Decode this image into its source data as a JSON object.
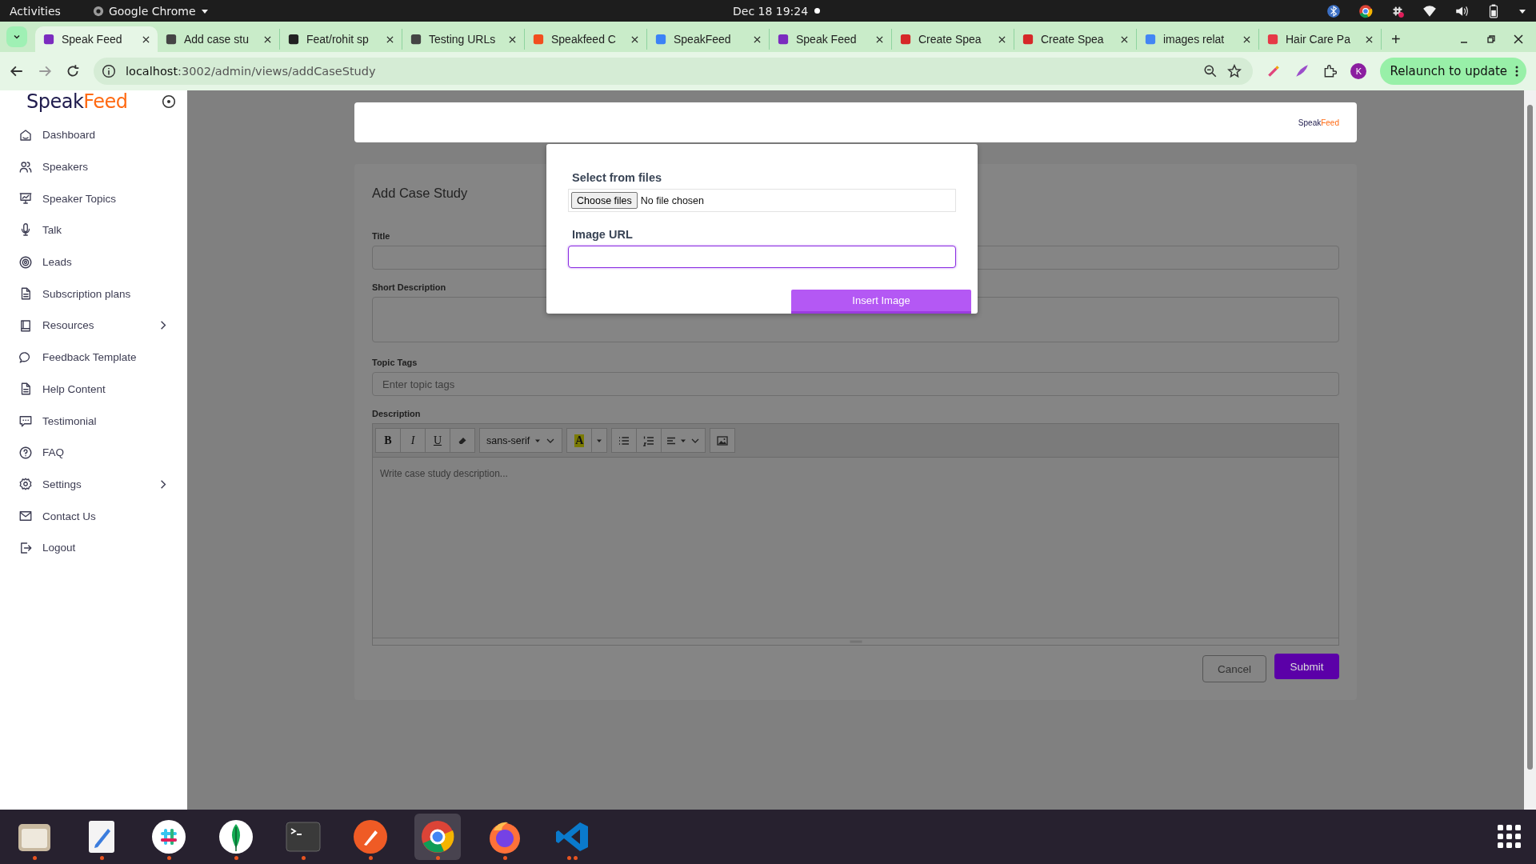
{
  "system_bar": {
    "activities": "Activities",
    "app_name": "Google Chrome",
    "clock": "Dec 18  19:24"
  },
  "browser": {
    "tabs": [
      {
        "title": "Speak Feed",
        "selected": true
      },
      {
        "title": "Add case stu",
        "selected": false
      },
      {
        "title": "Feat/rohit sp",
        "selected": false
      },
      {
        "title": "Testing URLs",
        "selected": false
      },
      {
        "title": "Speakfeed C",
        "selected": false
      },
      {
        "title": "SpeakFeed",
        "selected": false
      },
      {
        "title": "Speak Feed",
        "selected": false
      },
      {
        "title": "Create Spea",
        "selected": false
      },
      {
        "title": "Create Spea",
        "selected": false
      },
      {
        "title": "images relat",
        "selected": false
      },
      {
        "title": "Hair Care Pa",
        "selected": false
      }
    ],
    "new_tab": "+",
    "url_host": "localhost",
    "url_path": ":3002/admin/views/addCaseStudy",
    "profile_initial": "K",
    "relaunch_button": "Relaunch to update"
  },
  "sidebar": {
    "logo_first": "Speak",
    "logo_second": "Feed",
    "items": [
      {
        "label": "Dashboard",
        "expandable": false
      },
      {
        "label": "Speakers",
        "expandable": false
      },
      {
        "label": "Speaker Topics",
        "expandable": false
      },
      {
        "label": "Talk",
        "expandable": false
      },
      {
        "label": "Leads",
        "expandable": false
      },
      {
        "label": "Subscription plans",
        "expandable": false
      },
      {
        "label": "Resources",
        "expandable": true
      },
      {
        "label": "Feedback Template",
        "expandable": false
      },
      {
        "label": "Help Content",
        "expandable": false
      },
      {
        "label": "Testimonial",
        "expandable": false
      },
      {
        "label": "FAQ",
        "expandable": false
      },
      {
        "label": "Settings",
        "expandable": true
      },
      {
        "label": "Contact Us",
        "expandable": false
      },
      {
        "label": "Logout",
        "expandable": false
      }
    ]
  },
  "header": {
    "logo_first": "Speak",
    "logo_second": "Feed"
  },
  "form": {
    "title": "Add Case Study",
    "title_label": "Title",
    "short_description_label": "Short Description",
    "topic_tags_label": "Topic Tags",
    "topic_tags_placeholder": "Enter topic tags",
    "description_label": "Description",
    "toolbar": [
      [
        {
          "kind": "bold",
          "label": "B"
        },
        {
          "kind": "italic",
          "label": "I"
        },
        {
          "kind": "underline",
          "label": "U"
        },
        {
          "kind": "eraser"
        }
      ],
      [
        {
          "kind": "font",
          "label": "sans-serif"
        }
      ],
      [
        {
          "kind": "color",
          "label": "A"
        },
        {
          "kind": "color-caret"
        }
      ],
      [
        {
          "kind": "bullets"
        },
        {
          "kind": "numbers"
        },
        {
          "kind": "align"
        }
      ],
      [
        {
          "kind": "image"
        }
      ]
    ],
    "description_placeholder": "Write case study description...",
    "cancel_button": "Cancel",
    "submit_button": "Submit"
  },
  "modal": {
    "files_label": "Select from files",
    "choose_button": "Choose files",
    "file_status": "No file chosen",
    "url_label": "Image URL",
    "insert_button": "Insert Image"
  },
  "taskbar": {
    "apps": [
      {
        "running": true,
        "selected": false,
        "multi_window": false
      },
      {
        "running": true,
        "selected": false,
        "multi_window": false
      },
      {
        "running": true,
        "selected": false,
        "multi_window": false
      },
      {
        "running": true,
        "selected": false,
        "multi_window": false
      },
      {
        "running": true,
        "selected": false,
        "multi_window": false
      },
      {
        "running": true,
        "selected": false,
        "multi_window": false
      },
      {
        "running": true,
        "selected": true,
        "multi_window": false
      },
      {
        "running": true,
        "selected": false,
        "multi_window": false
      },
      {
        "running": true,
        "selected": false,
        "multi_window": true
      }
    ]
  }
}
